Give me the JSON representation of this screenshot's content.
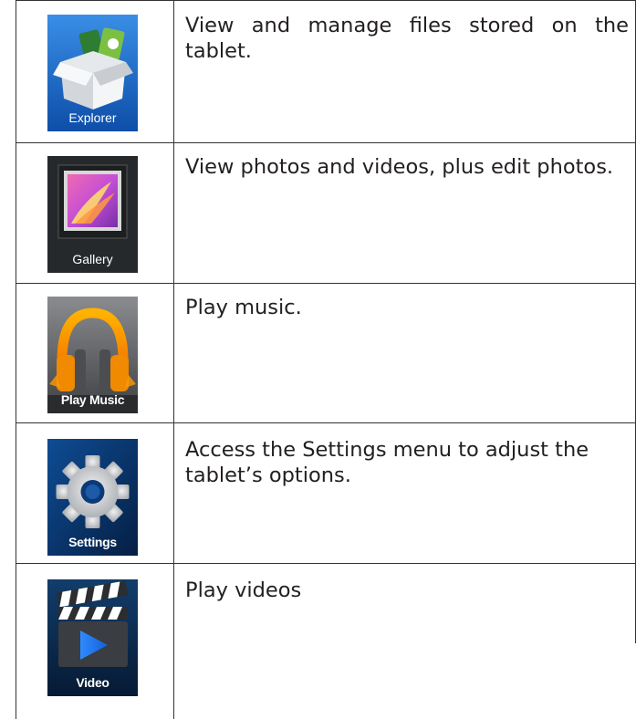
{
  "apps": [
    {
      "icon": "explorer-icon",
      "label": "Explorer",
      "description": "View and manage files stored on the tablet."
    },
    {
      "icon": "gallery-icon",
      "label": "Gallery",
      "description": "View photos and videos, plus edit photos."
    },
    {
      "icon": "play-music-icon",
      "label": "Play Music",
      "description": "Play music."
    },
    {
      "icon": "settings-icon",
      "label": "Settings",
      "description": "Access the Settings menu to adjust the tablet’s options."
    },
    {
      "icon": "video-icon",
      "label": "Video",
      "description": "Play videos"
    }
  ],
  "colors": {
    "explorer_bg": "#1a6fd1",
    "gallery_bg": "#26292c",
    "music_bg": "#5d5f62",
    "settings_bg": "#0a3a78",
    "video_bg": "#0b2b4e",
    "rule": "#333333",
    "text": "#231f20"
  }
}
